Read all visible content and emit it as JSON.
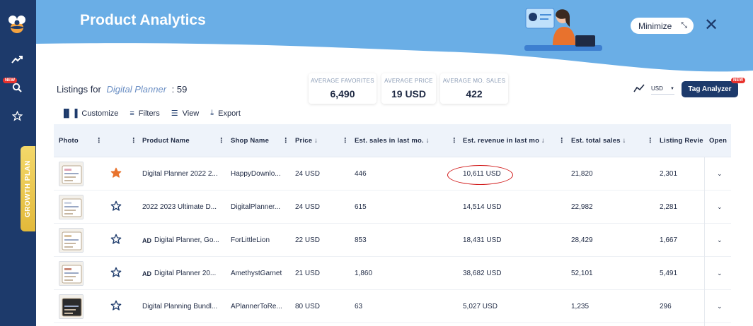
{
  "app": {
    "title": "Product Analytics",
    "minimize_label": "Minimize",
    "sidebar": {
      "new_badge": "NEW",
      "growth_plan": "GROWTH PLAN"
    }
  },
  "summary": {
    "listings_label": "Listings for",
    "keyword": "Digital Planner",
    "separator": ":",
    "count": "59",
    "stats": [
      {
        "label": "AVERAGE FAVORITES",
        "value": "6,490"
      },
      {
        "label": "AVERAGE PRICE",
        "value": "19 USD"
      },
      {
        "label": "AVERAGE MO. SALES",
        "value": "422"
      }
    ],
    "currency": "USD",
    "tag_analyzer": "Tag Analyzer",
    "tag_new_badge": "NEW"
  },
  "toolbar": {
    "customize": "Customize",
    "filters": "Filters",
    "view": "View",
    "export": "Export"
  },
  "table": {
    "headers": {
      "photo": "Photo",
      "product_name": "Product Name",
      "shop_name": "Shop Name",
      "price": "Price ↓",
      "est_sales": "Est. sales in last mo. ↓",
      "est_revenue": "Est. revenue in last mo ↓",
      "est_total": "Est. total sales ↓",
      "reviews": "Listing Revie",
      "open": "Open"
    },
    "ad_label": "AD",
    "rows": [
      {
        "ad": false,
        "favorite": true,
        "product": "Digital Planner 2022 2...",
        "shop": "HappyDownlo...",
        "price": "24 USD",
        "sales": "446",
        "revenue": "10,611 USD",
        "total": "21,820",
        "reviews": "2,301"
      },
      {
        "ad": false,
        "favorite": false,
        "product": "2022 2023 Ultimate D...",
        "shop": "DigitalPlanner...",
        "price": "24 USD",
        "sales": "615",
        "revenue": "14,514 USD",
        "total": "22,982",
        "reviews": "2,281"
      },
      {
        "ad": true,
        "favorite": false,
        "product": "Digital Planner, Go...",
        "shop": "ForLittleLion",
        "price": "22 USD",
        "sales": "853",
        "revenue": "18,431 USD",
        "total": "28,429",
        "reviews": "1,667"
      },
      {
        "ad": true,
        "favorite": false,
        "product": "Digital Planner 20...",
        "shop": "AmethystGarnet",
        "price": "21 USD",
        "sales": "1,860",
        "revenue": "38,682 USD",
        "total": "52,101",
        "reviews": "5,491"
      },
      {
        "ad": false,
        "favorite": false,
        "product": "Digital Planning Bundl...",
        "shop": "APlannerToRe...",
        "price": "80 USD",
        "sales": "63",
        "revenue": "5,027 USD",
        "total": "1,235",
        "reviews": "296"
      }
    ]
  },
  "colors": {
    "header_blue": "#6aaee6",
    "navy": "#1d3a6b",
    "star_orange": "#e8732d",
    "highlight_red": "#d11a1a"
  }
}
